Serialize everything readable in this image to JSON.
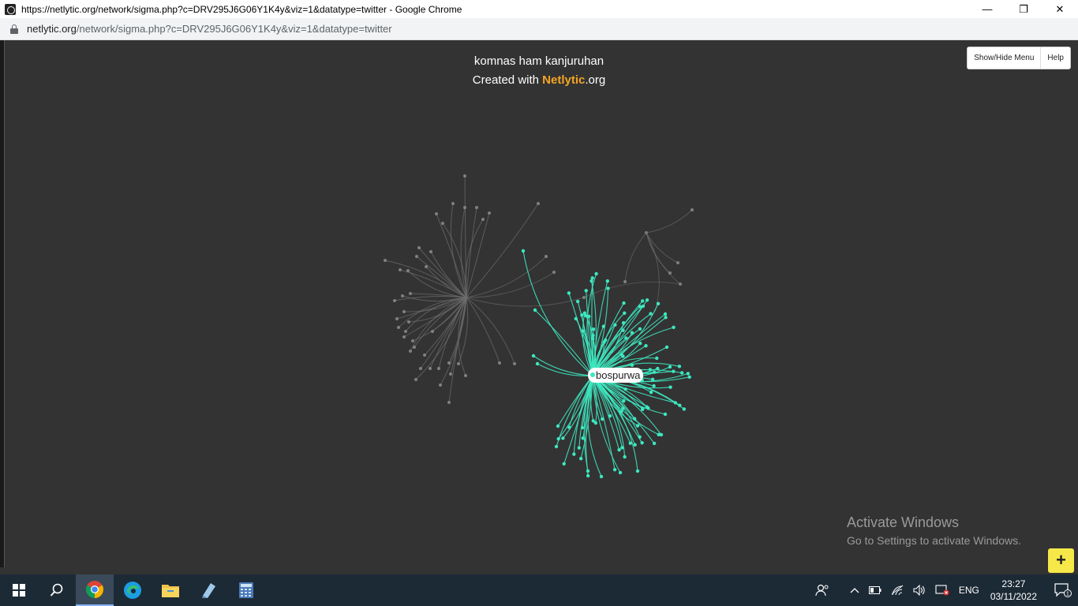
{
  "window": {
    "title": "https://netlytic.org/network/sigma.php?c=DRV295J6G06Y1K4y&viz=1&datatype=twitter - Google Chrome",
    "minimize": "—",
    "restore": "❐",
    "close": "✕"
  },
  "address": {
    "host": "netlytic.org",
    "path": "/network/sigma.php?c=DRV295J6G06Y1K4y&viz=1&datatype=twitter"
  },
  "graph": {
    "title": "komnas ham kanjuruhan",
    "subtitle_prefix": "Created with ",
    "brand": "Netlytic",
    "subtitle_suffix": ".org",
    "highlighted_node": "bospurwa",
    "colors": {
      "highlight": "#3de8c0",
      "dim": "#6e6e6e",
      "background": "#333333"
    }
  },
  "menu": {
    "show_hide": "Show/Hide Menu",
    "help": "Help"
  },
  "watermark": {
    "line1": "Activate Windows",
    "line2": "Go to Settings to activate Windows."
  },
  "zoom_button": "+",
  "taskbar": {
    "icons": [
      "start-icon",
      "search-icon",
      "chrome-icon",
      "edge-icon",
      "file-explorer-icon",
      "notepad-icon",
      "calculator-icon"
    ],
    "language": "ENG",
    "time": "23:27",
    "date": "03/11/2022",
    "notification_count": "1"
  }
}
